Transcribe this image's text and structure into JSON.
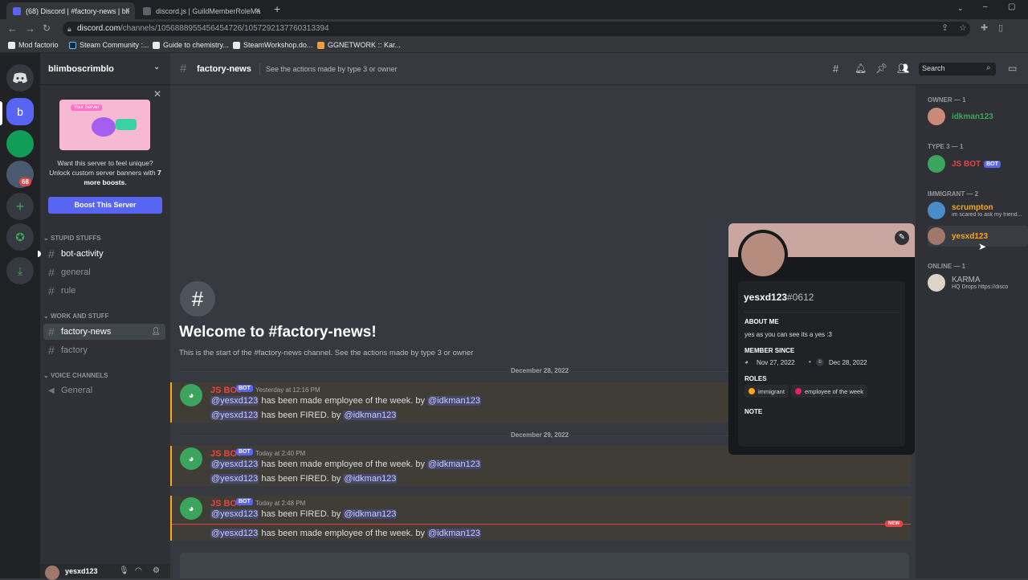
{
  "browser": {
    "tabs": [
      {
        "label": "(68) Discord | #factory-news | bli",
        "close": "×"
      },
      {
        "label": "discord.js | GuildMemberRoleMa",
        "close": "×"
      }
    ],
    "new_tab": "+",
    "url_domain": "discord.com",
    "url_path": "/channels/1056888955456454726/1057292137760313394",
    "bookmarks": [
      "Mod factorio",
      "Steam Community :...",
      "Guide to chemistry...",
      "SteamWorkshop.do...",
      "GGNETWORK :: Kar..."
    ]
  },
  "guilds": {
    "letter": "b",
    "notification": "68"
  },
  "sidebar": {
    "server_name": "blimboscrimblo",
    "boost_promo": {
      "image_label": "Your Server",
      "text": "Want this server to feel unique? Unlock custom server banners with",
      "bold": "7 more boosts.",
      "button": "Boost This Server"
    },
    "categories": [
      {
        "name": "STUPID STUFFS",
        "channels": [
          "bot-activity",
          "general",
          "rule"
        ]
      },
      {
        "name": "WORK AND STUFF",
        "channels": [
          "factory-news",
          "factory"
        ]
      },
      {
        "name": "VOICE CHANNELS",
        "channels": [
          "General"
        ]
      }
    ],
    "user": {
      "name": "yesxd123"
    }
  },
  "channel": {
    "name": "factory-news",
    "topic": "See the actions made by type 3 or owner",
    "search_placeholder": "Search",
    "welcome_title": "Welcome to #factory-news!",
    "welcome_sub": "This is the start of the #factory-news channel. See the actions made by type 3 or owner"
  },
  "messages": {
    "bot_badge": "BOT",
    "bot_name": "JS BOT",
    "divider1": "December 28, 2022",
    "divider2": "December 29, 2022",
    "new_badge": "NEW",
    "group1": {
      "time": "Yesterday at 12:16 PM",
      "lines": [
        {
          "user": "@yesxd123",
          "action": " has been made employee of the week. by ",
          "by": "@idkman123"
        },
        {
          "user": "@yesxd123",
          "action": " has been FIRED. by ",
          "by": "@idkman123"
        }
      ]
    },
    "group2": {
      "time": "Today at 2:40 PM",
      "lines": [
        {
          "user": "@yesxd123",
          "action": " has been made employee of the week. by ",
          "by": "@idkman123"
        },
        {
          "user": "@yesxd123",
          "action": " has been FIRED. by ",
          "by": "@idkman123"
        }
      ]
    },
    "group3": {
      "time": "Today at 2:48 PM",
      "lines": [
        {
          "user": "@yesxd123",
          "action": " has been FIRED. by ",
          "by": "@idkman123"
        },
        {
          "user": "@yesxd123",
          "action": " has been made employee of the week. by ",
          "by": "@idkman123"
        }
      ]
    }
  },
  "members": {
    "groups": [
      {
        "label": "OWNER — 1"
      },
      {
        "label": "TYPE 3 — 1"
      },
      {
        "label": "IMMIGRANT — 2"
      },
      {
        "label": "ONLINE — 1"
      }
    ],
    "owner": {
      "name": "idkman123",
      "color": "#3ba55d"
    },
    "type3": {
      "name": "JS BOT",
      "color": "#ed4245"
    },
    "immigrant1": {
      "name": "scrumpton",
      "status": "im scared to ask my friend...",
      "color": "#faa61a"
    },
    "immigrant2": {
      "name": "yesxd123",
      "color": "#faa61a"
    },
    "online1": {
      "name": "KARMA",
      "status": "HQ Drops https://disco",
      "color": "#b9bbbe"
    }
  },
  "popout": {
    "username": "yesxd123",
    "discriminator": "#0612",
    "about_label": "ABOUT ME",
    "about": "yes as you can see its a yes :3",
    "member_since_label": "MEMBER SINCE",
    "discord_since": "Nov 27, 2022",
    "server_since": "Dec 28, 2022",
    "roles_label": "ROLES",
    "roles": [
      {
        "name": "immigrant",
        "color": "#faa61a"
      },
      {
        "name": "employee of the week",
        "color": "#e91e63"
      }
    ],
    "note_label": "NOTE"
  }
}
